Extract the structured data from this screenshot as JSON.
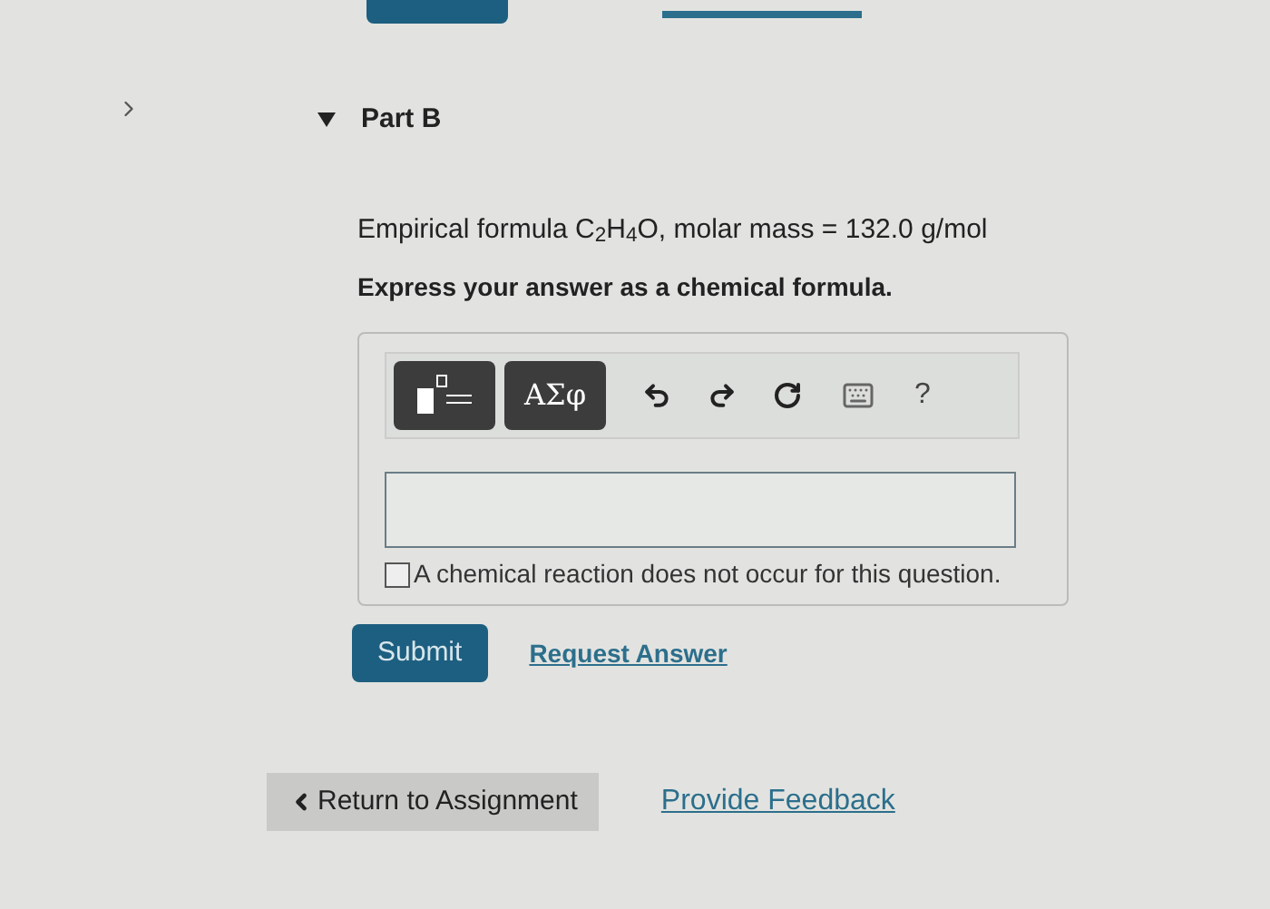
{
  "part": {
    "title": "Part B",
    "expanded": true
  },
  "question": {
    "statement": "Empirical formula C$_{2}$H$_{4}$O, molar mass = 132.0 g/mol",
    "instruction": "Express your answer as a chemical formula."
  },
  "toolbar": {
    "symbols_button": "ΑΣφ",
    "help": "?"
  },
  "no_reaction": {
    "label": "A chemical reaction does not occur for this question.",
    "checked": false
  },
  "actions": {
    "submit": "Submit",
    "request": "Request Answer"
  },
  "footer": {
    "return": "Return to Assignment",
    "feedback": "Provide Feedback"
  }
}
